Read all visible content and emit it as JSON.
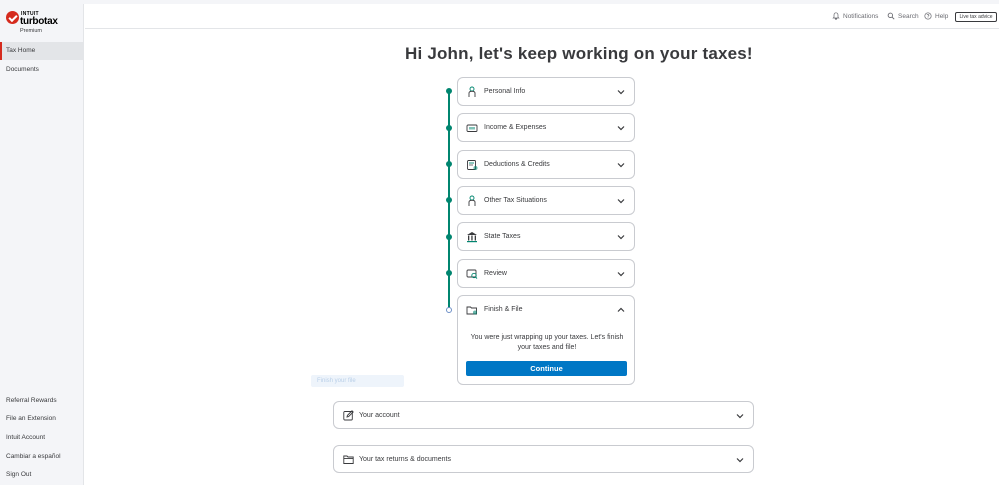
{
  "brand": {
    "company": "INTUIT",
    "product": "turbotax",
    "tier": "Premium"
  },
  "sidebar": {
    "items": [
      {
        "label": "Tax Home"
      },
      {
        "label": "Documents"
      },
      {
        "label": "Referral Rewards"
      },
      {
        "label": "File an Extension"
      },
      {
        "label": "Intuit Account"
      },
      {
        "label": "Cambiar a español"
      },
      {
        "label": "Sign Out"
      }
    ]
  },
  "header": {
    "notifications_label": "Notifications",
    "search_label": "Search",
    "help_label": "Help",
    "live_label": "Live tax advice"
  },
  "main": {
    "greeting": "Hi John, let's keep working on your taxes!",
    "sections": [
      {
        "label": "Personal Info",
        "icon": "person-icon",
        "status": "complete"
      },
      {
        "label": "Income & Expenses",
        "icon": "money-icon",
        "status": "complete"
      },
      {
        "label": "Deductions & Credits",
        "icon": "receipt-icon",
        "status": "complete"
      },
      {
        "label": "Other Tax Situations",
        "icon": "person-icon",
        "status": "complete"
      },
      {
        "label": "State Taxes",
        "icon": "building-icon",
        "status": "complete"
      },
      {
        "label": "Review",
        "icon": "review-icon",
        "status": "complete"
      },
      {
        "label": "Finish & File",
        "icon": "folder-icon",
        "status": "current"
      }
    ],
    "finish_text": "You were just wrapping up your taxes. Let's finish your taxes and file!",
    "continue_label": "Continue",
    "ghost_label": "Finish your file"
  },
  "bottom": {
    "account_label": "Your account",
    "returns_label": "Your tax returns & documents"
  },
  "colors": {
    "accent": "#0077c5",
    "timeline": "#00856f",
    "brand_red": "#d52b1e"
  }
}
